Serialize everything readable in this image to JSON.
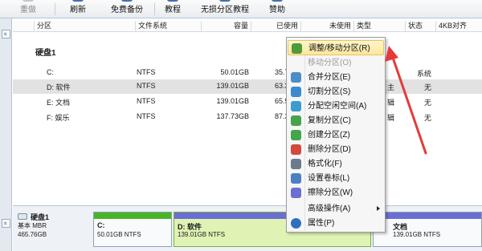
{
  "toolbar": {
    "items": [
      {
        "label": "重做",
        "dim": true
      },
      {
        "label": "刷新",
        "dim": false
      },
      {
        "label": "免费备份",
        "dim": false
      },
      {
        "label": "教程",
        "dim": false
      },
      {
        "label": "无损分区教程",
        "dim": false
      },
      {
        "label": "赞助",
        "dim": false
      }
    ]
  },
  "left_strip": {
    "up_glyph": "«",
    "down_glyph": "«"
  },
  "list": {
    "columns": [
      "分区",
      "文件系统",
      "容量",
      "已使用",
      "未使用",
      "类型",
      "状态",
      "4KB对齐"
    ],
    "disk_title": "硬盘1",
    "rows": [
      {
        "part": "C:",
        "fs": "NTFS",
        "cap": "50.01GB",
        "used": "35.7",
        "type": "",
        "status": "系统",
        "selected": false
      },
      {
        "part": "D: 软件",
        "fs": "NTFS",
        "cap": "139.01GB",
        "used": "63.3",
        "type": "主",
        "status": "无",
        "selected": true
      },
      {
        "part": "E: 文档",
        "fs": "NTFS",
        "cap": "139.01GB",
        "used": "65.9",
        "type": "辑",
        "status": "无",
        "selected": false
      },
      {
        "part": "F: 娱乐",
        "fs": "NTFS",
        "cap": "137.73GB",
        "used": "87.3",
        "type": "辑",
        "status": "无",
        "selected": false
      }
    ]
  },
  "disk_map": {
    "disk_name": "硬盘1",
    "disk_type": "基本 MBR",
    "disk_size": "465.76GB",
    "partitions": [
      {
        "name": "C:",
        "info": "50.01GB NTFS",
        "color": "#48b527"
      },
      {
        "name": "D: 软件",
        "info": "139.01GB NTFS",
        "color": "#6b6fd2"
      },
      {
        "name": "文档",
        "info": "139.01GB NTFS",
        "color": "#6b6fd2"
      }
    ]
  },
  "context_menu": {
    "items": [
      {
        "label": "调整/移动分区(R)",
        "icon": "resize-move-icon",
        "color": "#4f9a3a",
        "state": "highlighted"
      },
      {
        "label": "移动分区(O)",
        "icon": "",
        "color": "",
        "state": "disabled"
      },
      {
        "label": "合并分区(E)",
        "icon": "merge-icon",
        "color": "#4b8dc8",
        "state": "normal"
      },
      {
        "label": "切割分区(S)",
        "icon": "split-icon",
        "color": "#3e8ad1",
        "state": "normal"
      },
      {
        "label": "分配空闲空间(A)",
        "icon": "allocate-space-icon",
        "color": "#3d9ccf",
        "state": "normal"
      },
      {
        "label": "复制分区(C)",
        "icon": "copy-partition-icon",
        "color": "#47a24a",
        "state": "normal"
      },
      {
        "label": "创建分区(Z)",
        "icon": "create-partition-icon",
        "color": "#44a64b",
        "state": "normal"
      },
      {
        "label": "删除分区(D)",
        "icon": "delete-partition-icon",
        "color": "#d24a3c",
        "state": "normal"
      },
      {
        "label": "格式化(F)",
        "icon": "format-icon",
        "color": "#6c7b8c",
        "state": "normal"
      },
      {
        "label": "设置卷标(L)",
        "icon": "set-label-icon",
        "color": "#4c7fc2",
        "state": "normal"
      },
      {
        "label": "擦除分区(W)",
        "icon": "wipe-partition-icon",
        "color": "#6c6fd0",
        "state": "normal"
      },
      {
        "label": "高级操作(A)",
        "icon": "",
        "color": "",
        "state": "submenu"
      },
      {
        "label": "属性(P)",
        "icon": "properties-icon",
        "color": "#2f6fc0",
        "state": "normal"
      }
    ]
  }
}
